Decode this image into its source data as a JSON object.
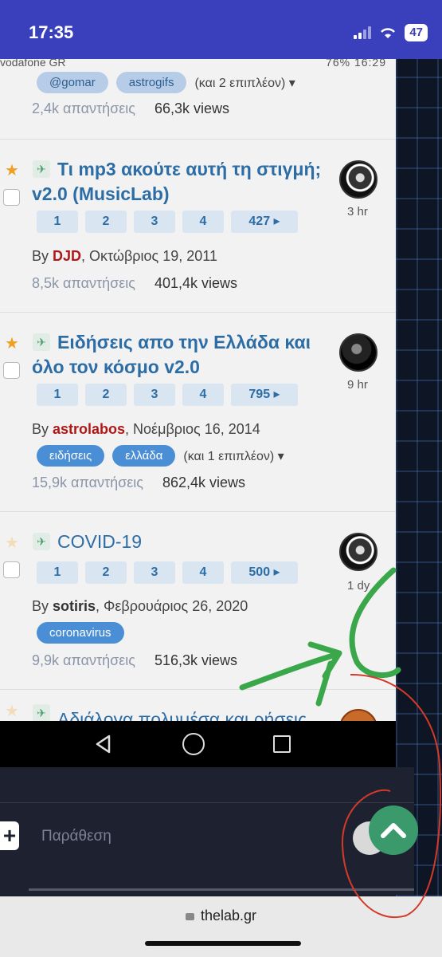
{
  "status_bar": {
    "time": "17:35",
    "battery": "47"
  },
  "embedded_status": {
    "carrier": "vodafone GR",
    "right": "76% 16:29"
  },
  "topic0": {
    "tags": [
      "@gomar",
      "astrogifs"
    ],
    "more": "(και 2 επιπλέον) ▾",
    "replies": "2,4k απαντήσεις",
    "views": "66,3k views"
  },
  "topics": [
    {
      "title": "Τι mp3 ακούτε αυτή τη στιγμή; v2.0 (MusicLab)",
      "pages": [
        "1",
        "2",
        "3",
        "4",
        "427 ▸"
      ],
      "by": "By ",
      "author": "DJD",
      "date": ", Οκτώβριος 19, 2011",
      "replies": "8,5k απαντήσεις",
      "views": "401,4k views",
      "time": "3 hr"
    },
    {
      "title": "Ειδήσεις απο την Ελλάδα και όλο τον κόσμο v2.0",
      "pages": [
        "1",
        "2",
        "3",
        "4",
        "795 ▸"
      ],
      "by": "By ",
      "author": "astrolabos",
      "date": ", Νοέμβριος 16, 2014",
      "tags": [
        "ειδήσεις",
        "ελλάδα"
      ],
      "more": "(και 1 επιπλέον) ▾",
      "replies": "15,9k απαντήσεις",
      "views": "862,4k views",
      "time": "9 hr"
    },
    {
      "title": "COVID-19",
      "pages": [
        "1",
        "2",
        "3",
        "4",
        "500 ▸"
      ],
      "by": "By ",
      "author": "sotiris",
      "date": ", Φεβρουάριος 26, 2020",
      "tags": [
        "coronavirus"
      ],
      "replies": "9,9k απαντήσεις",
      "views": "516,3k views",
      "time": "1 dy"
    }
  ],
  "partial_title": "Αδιάλογα πολυμέσα και ρήσεις",
  "reply": {
    "plus": "+",
    "placeholder": "Παράθεση"
  },
  "browser": {
    "url": "thelab.gr"
  },
  "colors": {
    "ios_status": "#3a3fbc",
    "link": "#2d6da6",
    "tag": "#4a8fd6",
    "scroll_top": "#3a9a6c",
    "annotation_green": "#3aa84a",
    "annotation_red": "#d33a2a"
  }
}
